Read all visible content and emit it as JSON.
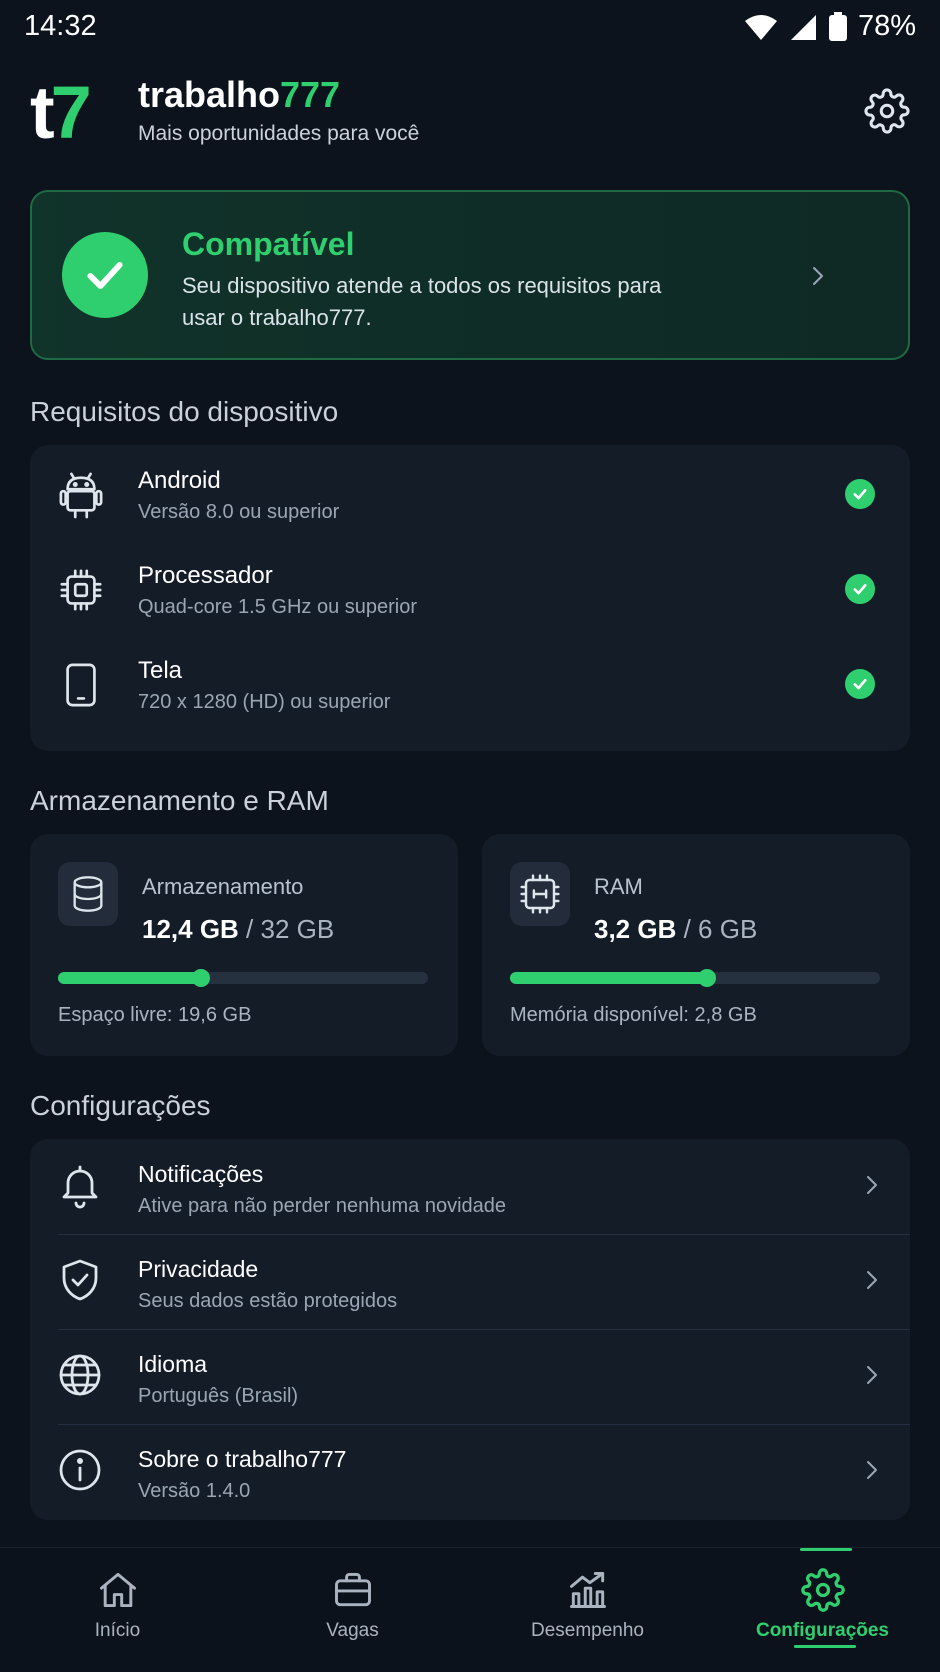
{
  "status_bar": {
    "time": "14:32",
    "battery": "78%",
    "icons": [
      "wifi-icon",
      "signal-icon",
      "battery-icon"
    ]
  },
  "header": {
    "logo_t": "t",
    "logo_7": "7",
    "brand_prefix": "trabalho",
    "brand_suffix": "777",
    "tagline": "Mais oportunidades para você",
    "settings_icon": "gear-icon"
  },
  "compat": {
    "title": "Compatível",
    "description": "Seu dispositivo atende a todos os requisitos para usar o trabalho777."
  },
  "requirements": {
    "section_title": "Requisitos do dispositivo",
    "items": [
      {
        "title": "Android",
        "subtitle": "Versão 8.0 ou superior",
        "icon": "android-icon"
      },
      {
        "title": "Processador",
        "subtitle": "Quad-core 1.5 GHz ou superior",
        "icon": "cpu-icon"
      },
      {
        "title": "Tela",
        "subtitle": "720 x 1280 (HD) ou superior",
        "icon": "phone-icon"
      }
    ]
  },
  "storage": {
    "section_title": "Armazenamento e RAM",
    "cards": [
      {
        "label": "Armazenamento",
        "used": "12,4 GB",
        "sep": " / ",
        "total": "32 GB",
        "footer": "Espaço livre: 19,6 GB",
        "fraction": 0.3875,
        "icon": "database-icon"
      },
      {
        "label": "RAM",
        "used": "3,2 GB",
        "sep": " / ",
        "total": "6 GB",
        "footer": "Memória disponível: 2,8 GB",
        "fraction": 0.5333,
        "icon": "memory-chip-icon"
      }
    ]
  },
  "settings": {
    "section_title": "Configurações",
    "items": [
      {
        "title": "Notificações",
        "subtitle": "Ative para não perder nenhuma novidade",
        "icon": "bell-icon"
      },
      {
        "title": "Privacidade",
        "subtitle": "Seus dados estão protegidos",
        "icon": "shield-icon"
      },
      {
        "title": "Idioma",
        "subtitle": "Português (Brasil)",
        "icon": "globe-icon"
      },
      {
        "title": "Sobre o trabalho777",
        "subtitle": "Versão 1.4.0",
        "icon": "info-icon"
      }
    ]
  },
  "nav": {
    "items": [
      {
        "label": "Início",
        "icon": "home-icon"
      },
      {
        "label": "Vagas",
        "icon": "briefcase-icon"
      },
      {
        "label": "Desempenho",
        "icon": "chart-icon"
      },
      {
        "label": "Configurações",
        "icon": "gear-icon"
      }
    ],
    "active": "Configurações"
  },
  "colors": {
    "accent": "#2fcf6f",
    "background": "#0c131d",
    "card": "#141c28"
  }
}
